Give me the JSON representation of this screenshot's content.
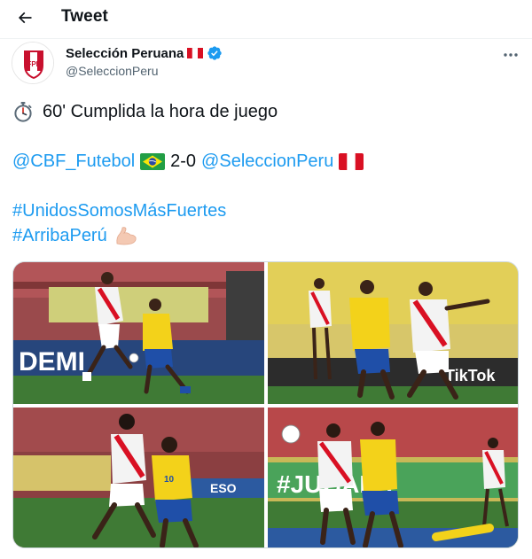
{
  "header": {
    "title": "Tweet",
    "back_icon": "arrow-left-icon"
  },
  "author": {
    "name": "Selección Peruana",
    "handle": "@SeleccionPeru",
    "verified": true,
    "flag_icon": "peru-flag-icon",
    "avatar_icon": "fpf-crest-icon"
  },
  "tweet": {
    "line1_text": "60' Cumplida la hora de juego",
    "line1_emoji": "stopwatch-icon",
    "score_team1": "@CBF_Futebol",
    "score": "2-0",
    "score_team2": "@SeleccionPeru",
    "hashtag1": "#UnidosSomosMásFuertes",
    "hashtag2": "#ArribaPerú",
    "hashtag2_emoji": "flexed-biceps-icon"
  },
  "media": {
    "count": 4,
    "photos": [
      {
        "name": "photo-1",
        "banner": "DEMI"
      },
      {
        "name": "photo-2",
        "banner": "TikTok"
      },
      {
        "name": "photo-3",
        "banner": "ESO"
      },
      {
        "name": "photo-4",
        "banner": "#JUGALA"
      }
    ]
  },
  "colors": {
    "link": "#1d9bf0",
    "secondary_text": "#536471",
    "verified": "#1d9bf0",
    "peru_red": "#d91023",
    "brazil_yellow": "#f3d21a",
    "brazil_blue": "#1f4fa8",
    "pitch_green": "#3f7a35"
  }
}
